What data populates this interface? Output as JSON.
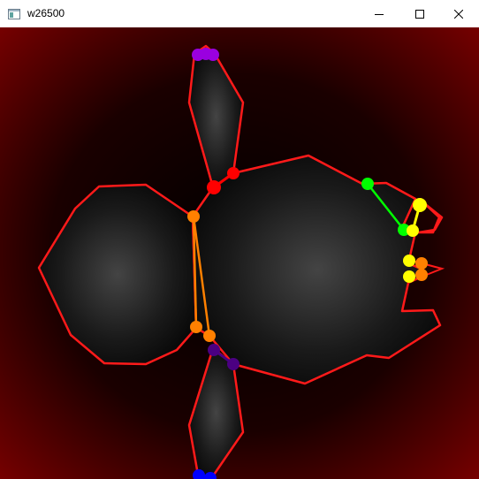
{
  "window": {
    "title": "w26500",
    "controls": {
      "minimize": "minimize-icon",
      "maximize": "maximize-icon",
      "close": "close-icon"
    }
  },
  "scene": {
    "background_edge_color": "#7a0000",
    "background_center_color": "#000000",
    "blob_highlight_color": "#444444",
    "outline_color": "#ff1a1a",
    "markers": [
      {
        "name": "top-cluster-markers",
        "color": "#9a00e0",
        "count": 3
      },
      {
        "name": "upper-joint-markers",
        "color": "#ff0000",
        "count": 2
      },
      {
        "name": "left-joint-marker",
        "color": "#ff8000",
        "count": 1
      },
      {
        "name": "lower-joint-markers",
        "color": "#ff8000",
        "count": 2
      },
      {
        "name": "bottom-joint-markers",
        "color": "#4b0082",
        "count": 2
      },
      {
        "name": "bottom-cluster-markers",
        "color": "#0000ff",
        "count": 2
      },
      {
        "name": "green-markers",
        "color": "#00ff00",
        "count": 2
      },
      {
        "name": "yellow-markers",
        "color": "#ffff00",
        "count": 4
      },
      {
        "name": "right-orange-markers",
        "color": "#ff8000",
        "count": 2
      }
    ]
  }
}
